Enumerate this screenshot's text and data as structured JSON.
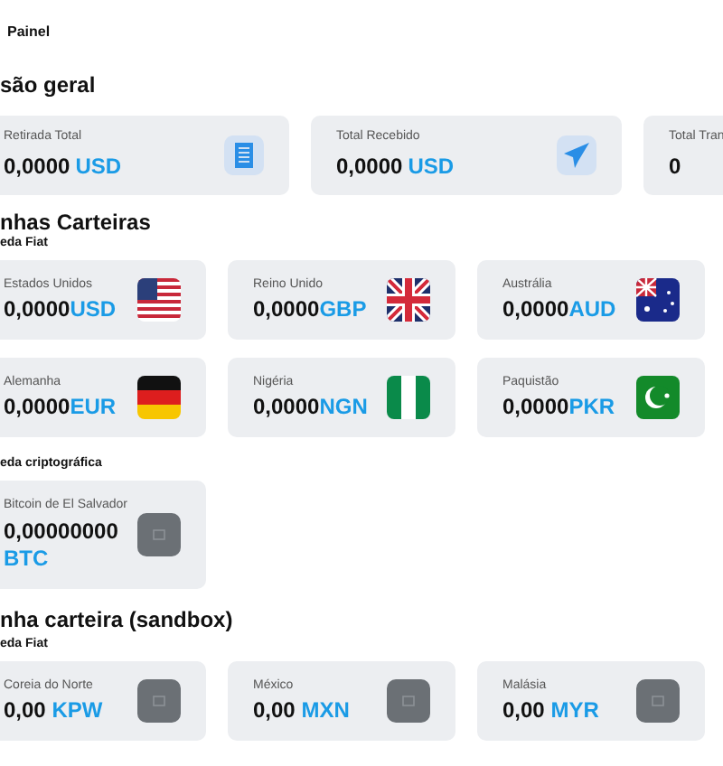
{
  "breadcrumb": "Painel",
  "overview": {
    "title": "são geral",
    "cards": [
      {
        "label": "Retirada Total",
        "amount": "0,0000",
        "currency": "USD"
      },
      {
        "label": "Total Recebido",
        "amount": "0,0000",
        "currency": "USD"
      },
      {
        "label": "Total Tran",
        "amount": "0"
      }
    ]
  },
  "wallets": {
    "title": "nhas Carteiras",
    "groups": [
      {
        "title": "eda Fiat",
        "items": [
          {
            "label": "Estados Unidos",
            "amount": "0,0000",
            "currency": "USD",
            "kind": "flag"
          },
          {
            "label": "Reino Unido",
            "amount": "0,0000",
            "currency": "GBP",
            "kind": "flag"
          },
          {
            "label": "Austrália",
            "amount": "0,0000",
            "currency": "AUD",
            "kind": "flag"
          },
          {
            "label": "Alemanha",
            "amount": "0,0000",
            "currency": "EUR",
            "kind": "flag"
          },
          {
            "label": "Nigéria",
            "amount": "0,0000",
            "currency": "NGN",
            "kind": "flag"
          },
          {
            "label": "Paquistão",
            "amount": "0,0000",
            "currency": "PKR",
            "kind": "flag"
          }
        ]
      },
      {
        "title": "eda criptográfica",
        "items": [
          {
            "label": "Bitcoin de El Salvador",
            "amount": "0,00000000",
            "currency": "BTC",
            "kind": "placeholder"
          }
        ]
      }
    ]
  },
  "sandbox": {
    "title": "nha carteira (sandbox)",
    "groups": [
      {
        "title": "eda Fiat",
        "items": [
          {
            "label": "Coreia do Norte",
            "amount": "0,00",
            "currency": "KPW",
            "kind": "placeholder"
          },
          {
            "label": "México",
            "amount": "0,00",
            "currency": "MXN",
            "kind": "placeholder"
          },
          {
            "label": "Malásia",
            "amount": "0,00",
            "currency": "MYR",
            "kind": "placeholder"
          }
        ]
      }
    ]
  }
}
